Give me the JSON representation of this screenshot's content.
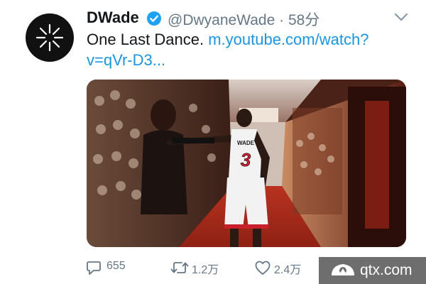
{
  "tweet": {
    "display_name": "DWade",
    "handle": "@DwyaneWade",
    "separator": " · ",
    "timestamp": "58分",
    "text_plain": "One Last Dance. ",
    "link_line1": "m.youtube.com/watch?",
    "link_line2": "v=qVr-D3...",
    "verified": true
  },
  "media": {
    "jersey_name": "WADE",
    "jersey_number": "3"
  },
  "actions": {
    "replies": "655",
    "retweets": "1.2万",
    "likes": "2.4万"
  },
  "watermark": {
    "site": "qtx.com"
  },
  "colors": {
    "link": "#1b95e0",
    "verified": "#1da1f2",
    "text_primary": "#14171a",
    "text_secondary": "#657786"
  },
  "icons": {
    "avatar": "xpress-logo-icon",
    "verified": "verified-badge-icon",
    "menu": "chevron-down-icon",
    "reply": "reply-icon",
    "retweet": "retweet-icon",
    "like": "heart-icon"
  }
}
